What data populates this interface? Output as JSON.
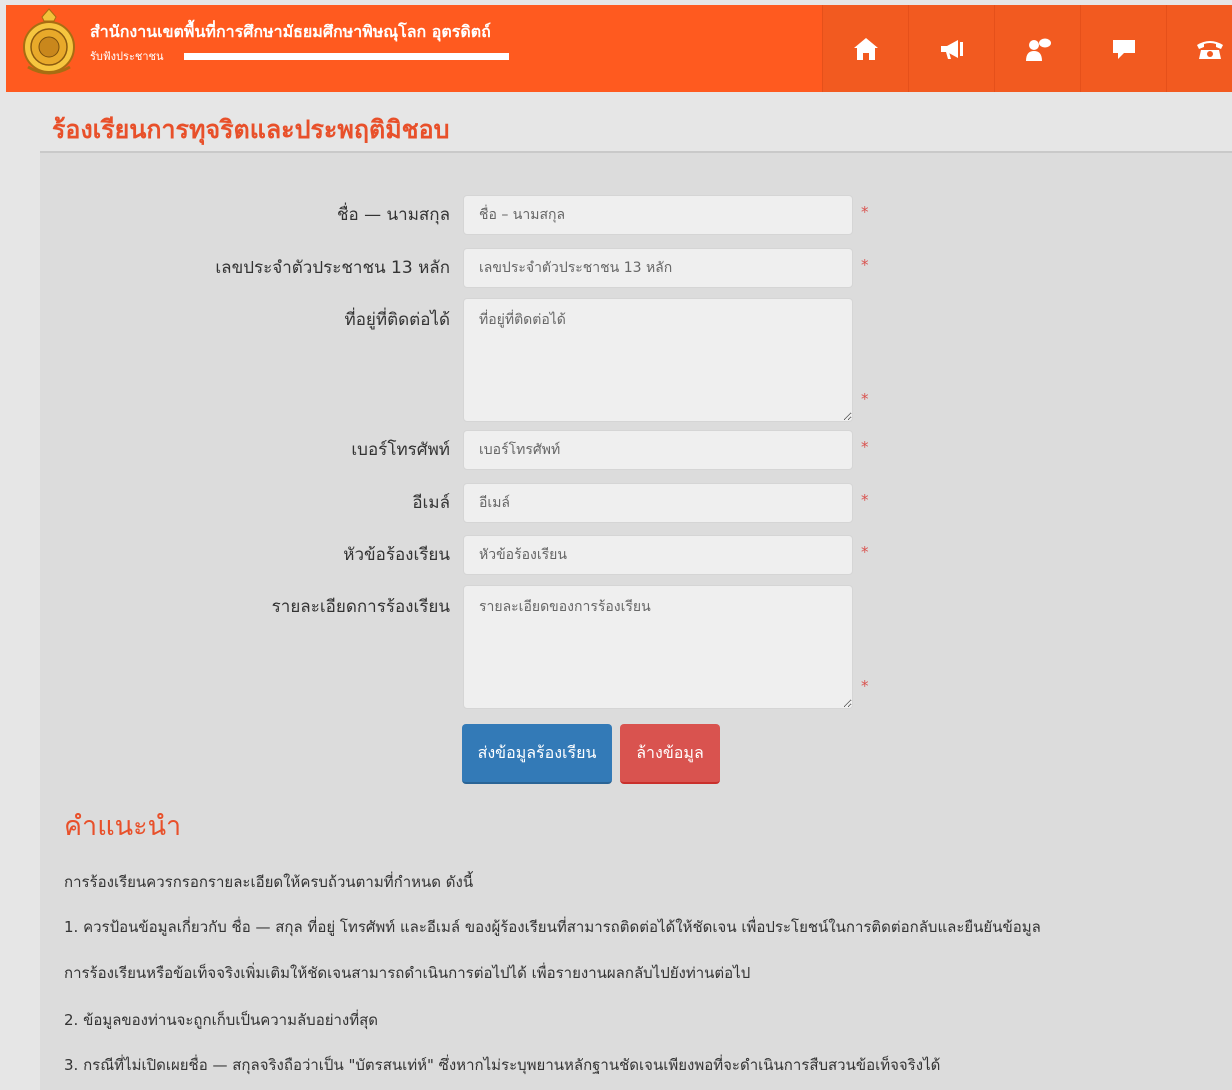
{
  "header": {
    "org_name": "สำนักงานเขตพื้นที่การศึกษามัธยมศึกษาพิษณุโลก อุตรดิตถ์",
    "subtitle": "รับฟังประชาชน",
    "nav": [
      {
        "icon": "home-icon"
      },
      {
        "icon": "megaphone-icon"
      },
      {
        "icon": "user-comment-icon"
      },
      {
        "icon": "chat-icon"
      },
      {
        "icon": "phone-icon"
      }
    ]
  },
  "page": {
    "title": "ร้องเรียนการทุจริตและประพฤติมิชอบ"
  },
  "form": {
    "name_label": "ชื่อ — นามสกุล",
    "name_placeholder": "ชื่อ – นามสกุล",
    "id_label": "เลขประจำตัวประชาชน 13 หลัก",
    "id_placeholder": "เลขประจำตัวประชาชน 13 หลัก",
    "address_label": "ที่อยู่ที่ติดต่อได้",
    "address_placeholder": "ที่อยู่ที่ติดต่อได้",
    "phone_label": "เบอร์โทรศัพท์",
    "phone_placeholder": "เบอร์โทรศัพท์",
    "email_label": "อีเมล์",
    "email_placeholder": "อีเมล์",
    "subject_label": "หัวข้อร้องเรียน",
    "subject_placeholder": "หัวข้อร้องเรียน",
    "detail_label": "รายละเอียดการร้องเรียน",
    "detail_placeholder": "รายละเอียดของการร้องเรียน",
    "required_mark": "*",
    "submit_label": "ส่งข้อมูลร้องเรียน",
    "reset_label": "ล้างข้อมูล"
  },
  "guide": {
    "title": "คำแนะนำ",
    "intro": "การร้องเรียนควรกรอกรายละเอียดให้ครบถ้วนตามที่กำหนด ดังนี้",
    "item1_line1": "1. ควรป้อนข้อมูลเกี่ยวกับ ชื่อ — สกุล ที่อยู่ โทรศัพท์ และอีเมล์ ของผู้ร้องเรียนที่สามารถติดต่อได้ให้ชัดเจน เพื่อประโยชน์ในการติดต่อกลับและยืนยันข้อมูล",
    "item1_line2": "การร้องเรียนหรือข้อเท็จจริงเพิ่มเติมให้ชัดเจนสามารถดำเนินการต่อไปได้ เพื่อรายงานผลกลับไปยังท่านต่อไป",
    "item2": "2. ข้อมูลของท่านจะถูกเก็บเป็นความลับอย่างที่สุด",
    "item3": "3. กรณีที่ไม่เปิดเผยชื่อ — สกุลจริงถือว่าเป็น \"บัตรสนเท่ห์\" ซึ่งหากไม่ระบุพยานหลักฐานชัดเจนเพียงพอที่จะดำเนินการสืบสวนข้อเท็จจริงได้"
  },
  "colors": {
    "header_bg": "#ff5a1f",
    "accent": "#e8502a",
    "submit": "#337ab7",
    "reset": "#d9534f"
  }
}
